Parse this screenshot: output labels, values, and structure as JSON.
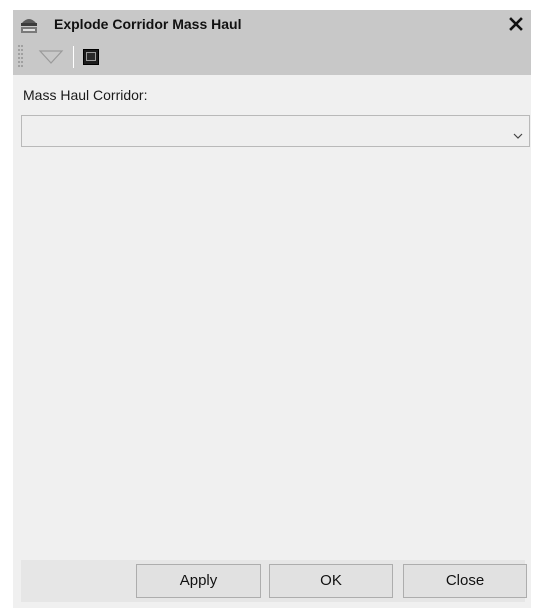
{
  "window": {
    "title": "Explode Corridor Mass Haul",
    "icon": "mass-haul-icon",
    "close_icon": "close-icon"
  },
  "toolbar": {
    "items": [
      {
        "name": "triangle-down-icon"
      },
      {
        "name": "command-window-icon"
      }
    ]
  },
  "form": {
    "corridor_label": "Mass Haul Corridor:",
    "corridor_value": ""
  },
  "buttons": {
    "apply": "Apply",
    "ok": "OK",
    "close": "Close"
  },
  "colors": {
    "titlebar_bg": "#c8c8c8",
    "dialog_bg": "#f0f0f0",
    "button_bg": "#e1e1e1"
  }
}
